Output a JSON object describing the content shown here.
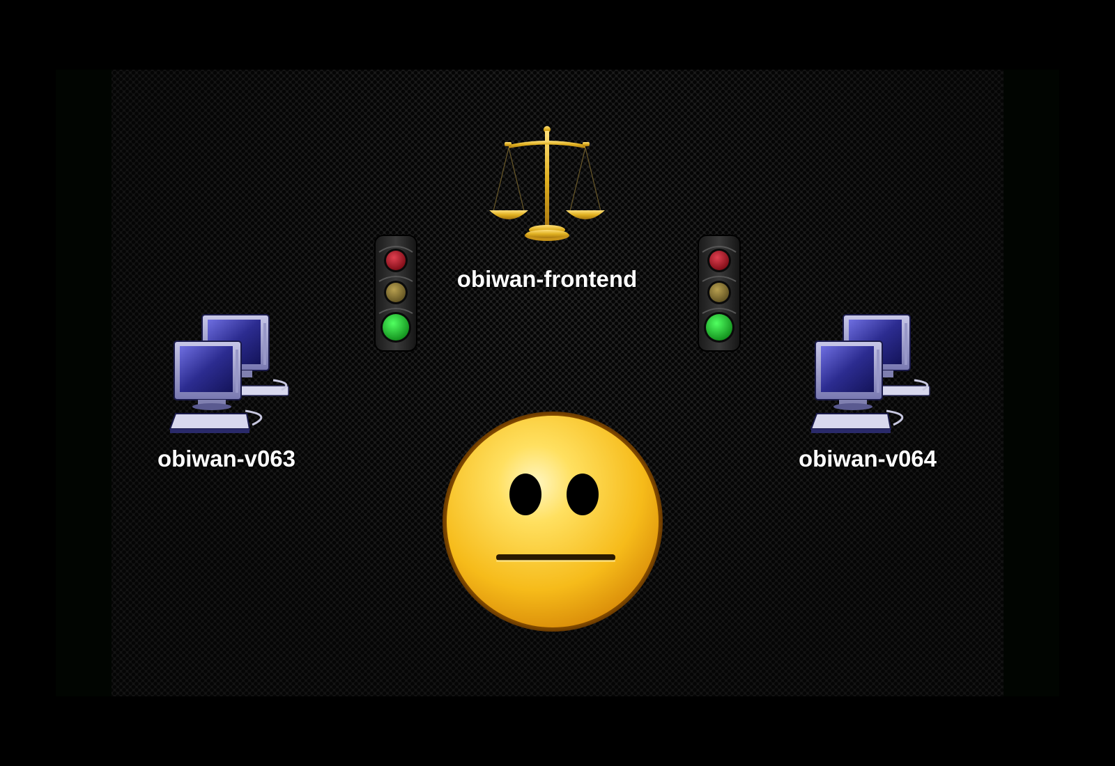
{
  "nodes": {
    "frontend": {
      "label": "obiwan-frontend",
      "icon": "balance-scale-icon"
    },
    "backend_left": {
      "label": "obiwan-v063",
      "icon": "computer-cluster-icon"
    },
    "backend_right": {
      "label": "obiwan-v064",
      "icon": "computer-cluster-icon"
    }
  },
  "traffic_lights": {
    "left": {
      "active": "green",
      "icon": "traffic-light-icon"
    },
    "right": {
      "active": "green",
      "icon": "traffic-light-icon"
    }
  },
  "status_face": {
    "icon": "neutral-face-icon",
    "mood": "neutral"
  },
  "colors": {
    "background": "#000000",
    "slide": "#141414",
    "label_text": "#ffffff",
    "scale_gold": "#e0b020",
    "light_red": "#b01020",
    "light_yellow": "#8a7a30",
    "light_green": "#1fbf2f",
    "face_yellow": "#f6c21e",
    "monitor_blue": "#3a3aa0"
  }
}
